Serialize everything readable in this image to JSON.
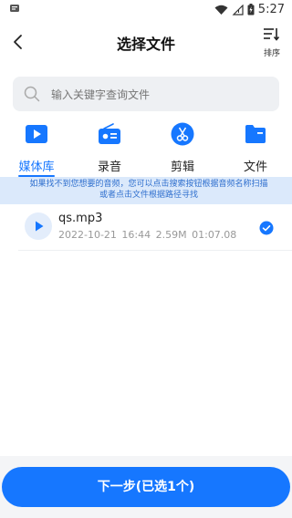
{
  "status_bar": {
    "time": "5:27"
  },
  "nav": {
    "title": "选择文件",
    "sort_label": "排序"
  },
  "search": {
    "placeholder": "输入关键字查询文件"
  },
  "tabs": [
    {
      "label": "媒体库",
      "icon": "play-icon"
    },
    {
      "label": "录音",
      "icon": "radio-icon"
    },
    {
      "label": "剪辑",
      "icon": "scissors-icon"
    },
    {
      "label": "文件",
      "icon": "folder-icon"
    }
  ],
  "notice": "如果找不到您想要的音频，您可以点击搜索按钮根据音频名称扫描或者点击文件根据路径寻找",
  "files": [
    {
      "name": "qs.mp3",
      "date": "2022-10-21 16:44",
      "size": "2.59M",
      "duration": "01:07.08",
      "selected": true
    }
  ],
  "next_button": "下一步(已选1个)",
  "colors": {
    "accent": "#1677ff",
    "notice_bg": "#dbe9fb",
    "notice_text": "#2f6fce"
  }
}
